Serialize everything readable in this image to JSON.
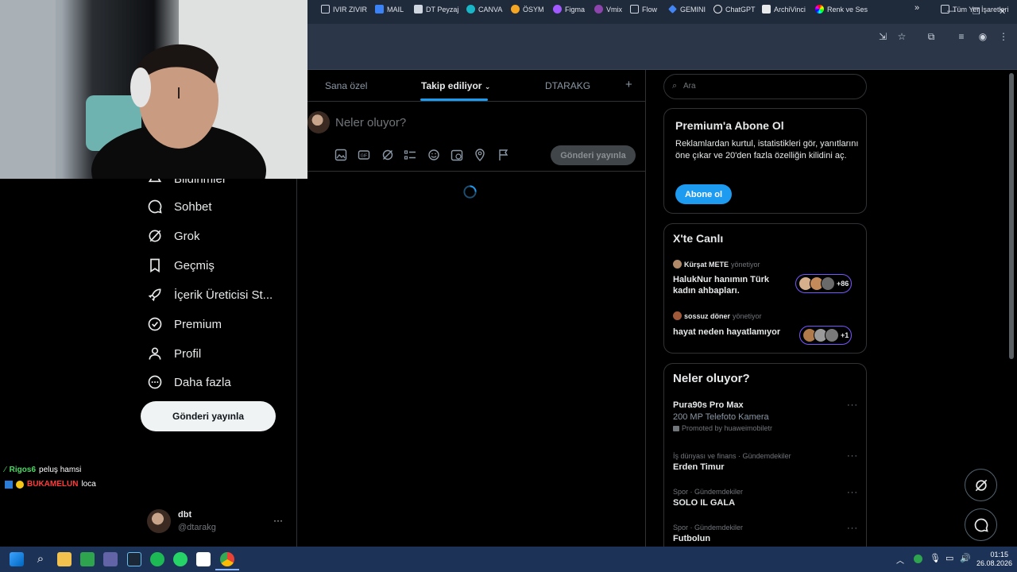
{
  "browser": {
    "bookmarks": [
      "IVIR ZIVIR",
      "MAIL",
      "DT Peyzaj",
      "CANVA",
      "ÖSYM",
      "Figma",
      "Vmix",
      "Flow",
      "GEMINI",
      "ChatGPT",
      "ArchiVinci",
      "Renk ve Ses"
    ],
    "all_bookmarks": "Tüm Yer İşaretleri",
    "more_bookmarks": "»"
  },
  "sidebar": {
    "partial_item": "Bildirimler",
    "items": [
      "Sohbet",
      "Grok",
      "Geçmiş",
      "İçerik Üreticisi St...",
      "Premium",
      "Profil",
      "Daha fazla"
    ],
    "post_button": "Gönderi yayınla",
    "account": {
      "name": "dbt",
      "handle": "@dtarakg",
      "more": "···"
    }
  },
  "tabs": [
    "Sana özel",
    "Takip ediliyor",
    "DTARAKG"
  ],
  "tabs_add": "+",
  "compose": {
    "placeholder": "Neler oluyor?",
    "post_button": "Gönderi yayınla"
  },
  "search": {
    "placeholder": "Ara"
  },
  "premium": {
    "title": "Premium'a Abone Ol",
    "text": "Reklamlardan kurtul, istatistikleri gör, yanıtlarını öne çıkar ve 20'den fazla özelliğin kilidini aç.",
    "button": "Abone ol"
  },
  "live": {
    "title": "X'te Canlı",
    "items": [
      {
        "host": "Kürşat METE",
        "role": "yönetiyor",
        "title": "HalukNur hanımın Türk kadın ahbapları.",
        "count": "+86"
      },
      {
        "host": "sossuz döner",
        "role": "yönetiyor",
        "title": "hayat neden hayatlamıyor",
        "count": "+1"
      }
    ]
  },
  "trends": {
    "title": "Neler oluyor?",
    "items": [
      {
        "name": "Pura90s Pro Max",
        "sub": "200 MP Telefoto Kamera",
        "meta": "Promoted by huaweimobiletr"
      },
      {
        "context": "İş dünyası ve finans · Gündemdekiler",
        "name": "Erden Timur"
      },
      {
        "context": "Spor · Gündemdekiler",
        "name": "SOLO IL GALA"
      },
      {
        "context": "Spor · Gündemdekiler",
        "name": "Futbolun"
      }
    ]
  },
  "chat": [
    {
      "user": "Rigos6",
      "msg": "peluş hamsi",
      "color": "#4cd964"
    },
    {
      "user": "BUKAMELUN",
      "msg": "loca",
      "color": "#ff3b3b"
    }
  ],
  "taskbar": {
    "time": "01:15",
    "date": "26.08.2026"
  },
  "colors": {
    "accent": "#1d9bf0",
    "live_border": "#7856ff",
    "divider": "#2f3336"
  }
}
